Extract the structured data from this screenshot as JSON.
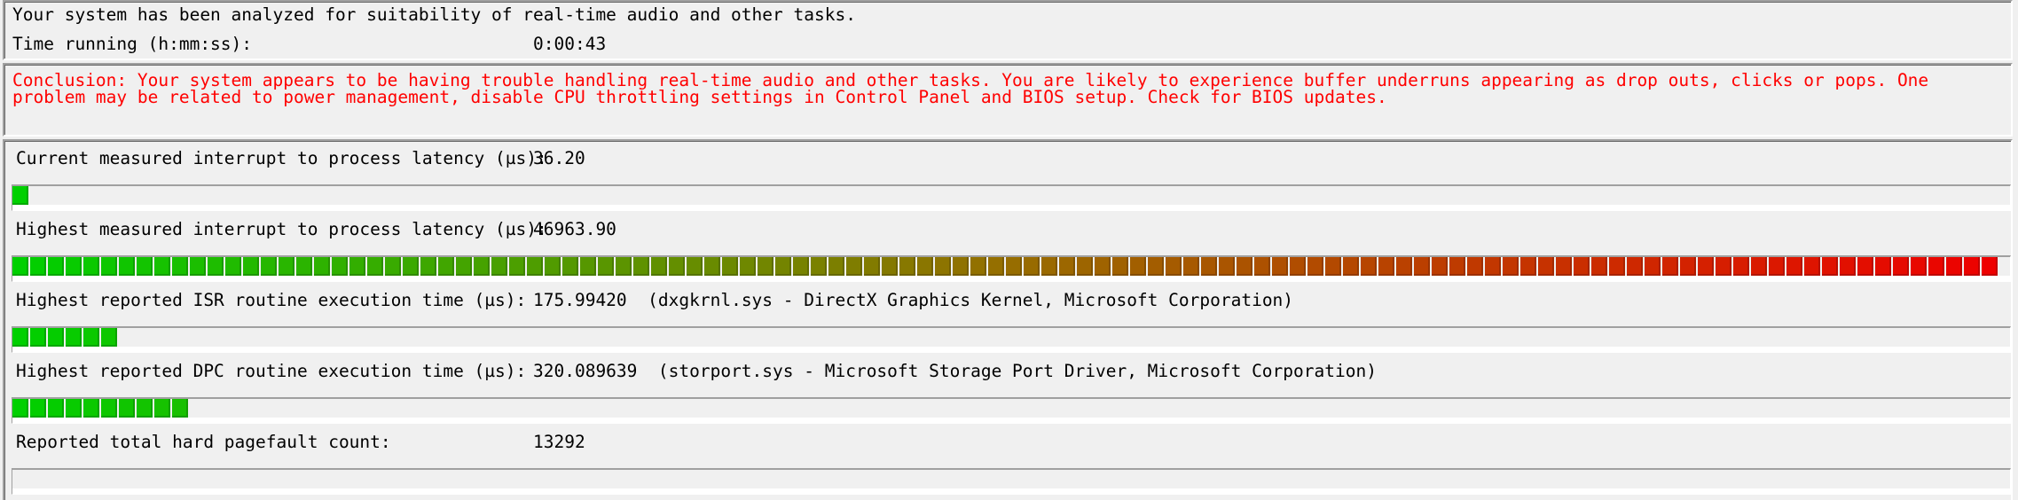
{
  "header": {
    "analyzed_text": "Your system has been analyzed for suitability of real-time audio and other tasks.",
    "time_label": "Time running (h:mm:ss):",
    "time_value": "0:00:43"
  },
  "conclusion": {
    "text": "Conclusion: Your system appears to be having trouble handling real-time audio and other tasks. You are likely to experience buffer underruns appearing as drop outs, clicks or pops. One problem may be related to power management, disable CPU throttling settings in Control Panel and BIOS setup. Check for BIOS updates.",
    "color": "#ff0000"
  },
  "metrics": [
    {
      "label": "Current measured interrupt to process latency (µs):",
      "value": "36.20",
      "detail": "",
      "bar_fraction": 0.008
    },
    {
      "label": "Highest measured interrupt to process latency (µs):",
      "value": "46963.90",
      "detail": "",
      "bar_fraction": 1.0
    },
    {
      "label": "Highest reported ISR routine execution time (µs):",
      "value": "175.99420",
      "detail": "(dxgkrnl.sys - DirectX Graphics Kernel, Microsoft Corporation)",
      "bar_fraction": 0.052
    },
    {
      "label": "Highest reported DPC routine execution time (µs):",
      "value": "320.089639",
      "detail": "(storport.sys - Microsoft Storage Port Driver, Microsoft Corporation)",
      "bar_fraction": 0.088
    },
    {
      "label": "Reported total hard pagefault count:",
      "value": "13292",
      "detail": "",
      "bar_fraction": 0.0
    }
  ],
  "colors": {
    "bar_low": "#00d000",
    "bar_high": "#ee0000",
    "panel_bg": "#f0f0f0"
  }
}
